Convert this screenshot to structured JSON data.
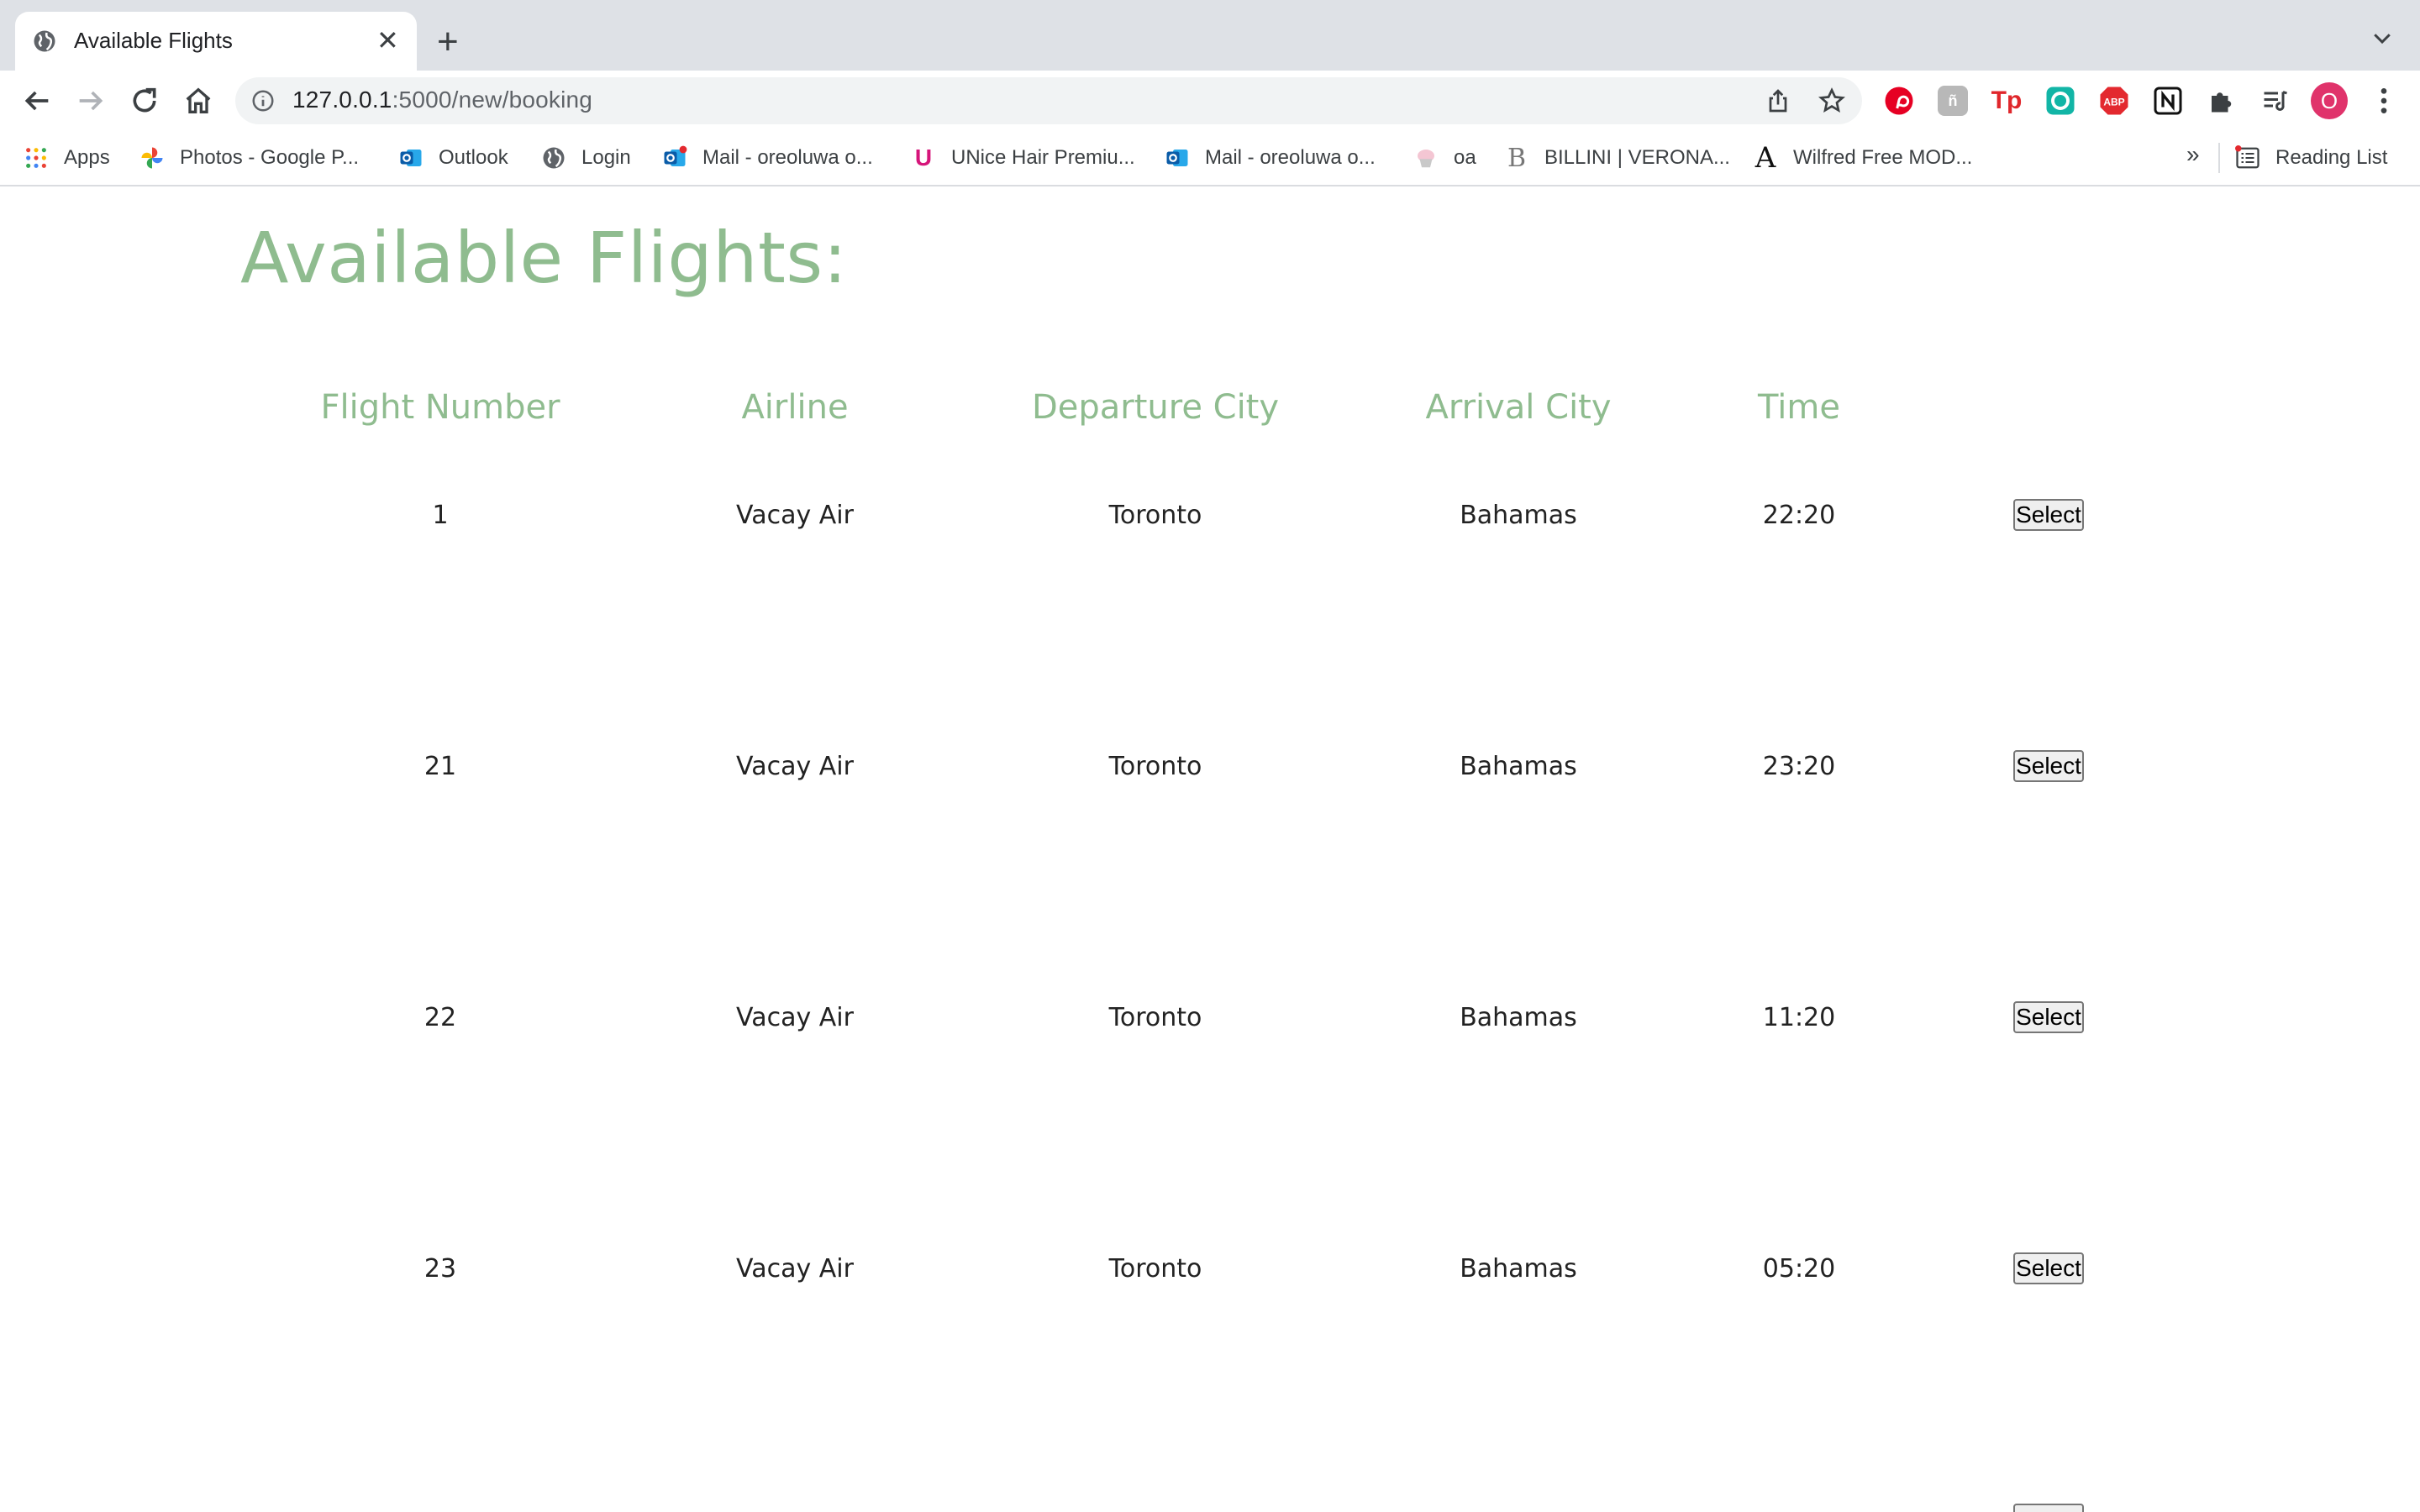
{
  "browser": {
    "tab": {
      "title": "Available Flights"
    },
    "address": {
      "host": "127.0.0.1",
      "rest": ":5000/new/booking"
    },
    "profile_initial": "O",
    "bookmarks": [
      {
        "label": "Apps",
        "icon": "apps-grid-icon"
      },
      {
        "label": "Photos - Google P...",
        "icon": "google-photos-icon"
      },
      {
        "label": "Outlook",
        "icon": "outlook-icon"
      },
      {
        "label": "Login",
        "icon": "globe-icon"
      },
      {
        "label": "Mail - oreoluwa o...",
        "icon": "outlook-mail-icon"
      },
      {
        "label": "UNice Hair Premiu...",
        "icon": "unice-icon"
      },
      {
        "label": "Mail - oreoluwa o...",
        "icon": "outlook-mail-icon"
      },
      {
        "label": "oa",
        "icon": "cupcake-icon"
      },
      {
        "label": "BILLINI | VERONA...",
        "icon": "billini-icon"
      },
      {
        "label": "Wilfred Free MOD...",
        "icon": "aritzia-icon"
      }
    ],
    "more_bookmarks": "»",
    "reading_list": "Reading List"
  },
  "page": {
    "title": "Available Flights:",
    "columns": [
      "Flight Number",
      "Airline",
      "Departure City",
      "Arrival City",
      "Time"
    ],
    "select_label": "Select",
    "rows": [
      {
        "flight_number": "1",
        "airline": "Vacay Air",
        "departure": "Toronto",
        "arrival": "Bahamas",
        "time": "22:20"
      },
      {
        "flight_number": "21",
        "airline": "Vacay Air",
        "departure": "Toronto",
        "arrival": "Bahamas",
        "time": "23:20"
      },
      {
        "flight_number": "22",
        "airline": "Vacay Air",
        "departure": "Toronto",
        "arrival": "Bahamas",
        "time": "11:20"
      },
      {
        "flight_number": "23",
        "airline": "Vacay Air",
        "departure": "Toronto",
        "arrival": "Bahamas",
        "time": "05:20"
      }
    ]
  },
  "colors": {
    "accent_green": "#8fbc8f",
    "tab_strip": "#dee1e6",
    "profile": "#e0336b"
  }
}
